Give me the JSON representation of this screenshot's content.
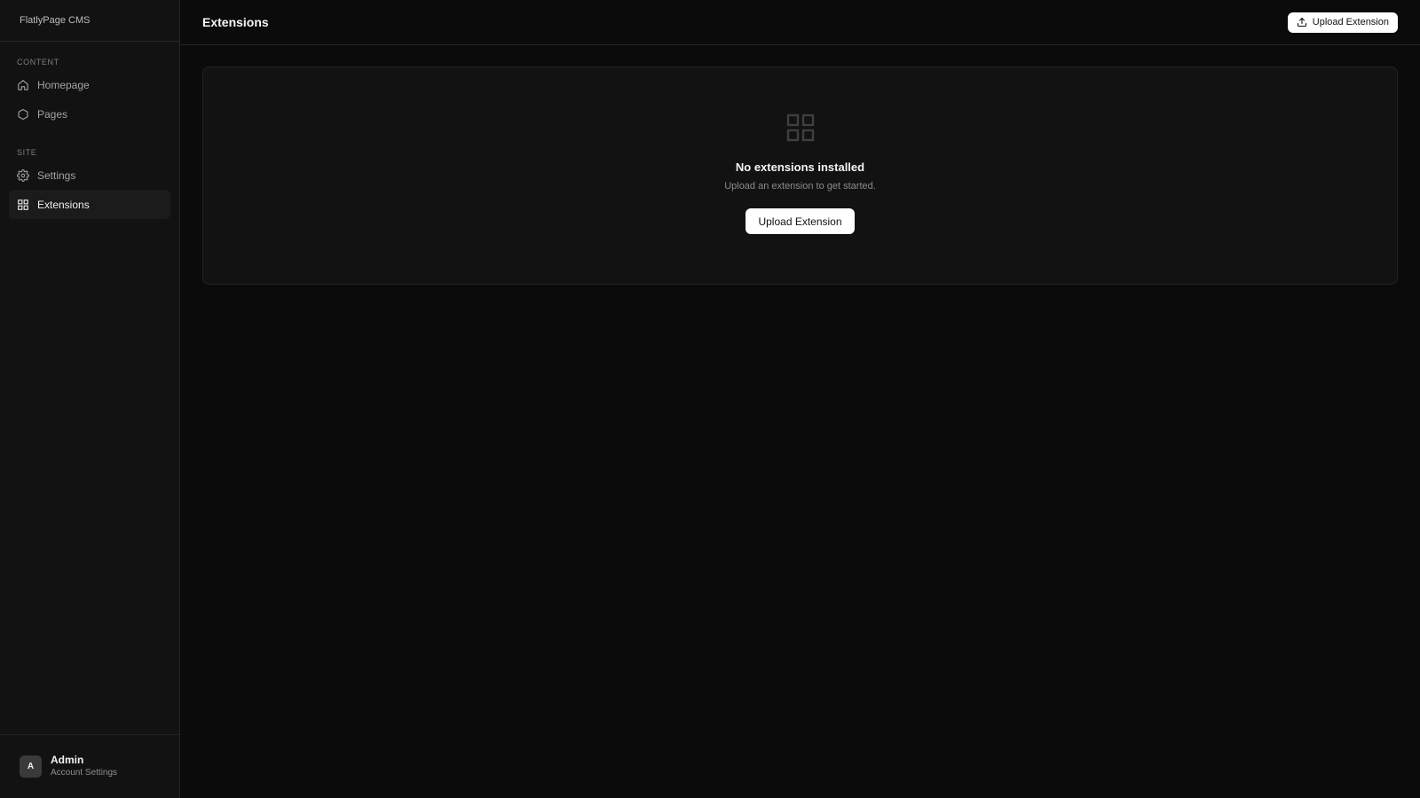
{
  "app": {
    "brand": "FlatlyPage CMS"
  },
  "sidebar": {
    "sections": [
      {
        "label": "CONTENT"
      },
      {
        "label": "SITE"
      }
    ],
    "items": [
      {
        "label": "Homepage",
        "icon": "home-icon"
      },
      {
        "label": "Pages",
        "icon": "hexagon-icon"
      },
      {
        "label": "Settings",
        "icon": "gear-icon"
      },
      {
        "label": "Extensions",
        "icon": "grid-icon",
        "active": true
      }
    ]
  },
  "user": {
    "initial": "A",
    "name": "Admin",
    "subtitle": "Account Settings"
  },
  "header": {
    "title": "Extensions",
    "upload_label": "Upload Extension"
  },
  "empty_state": {
    "icon": "grid-icon",
    "title": "No extensions installed",
    "subtitle": "Upload an extension to get started.",
    "button_label": "Upload Extension"
  },
  "colors": {
    "background": "#0b0b0b",
    "sidebar": "#121212",
    "card": "#121212",
    "border": "#242424",
    "button": "#ffffff"
  }
}
